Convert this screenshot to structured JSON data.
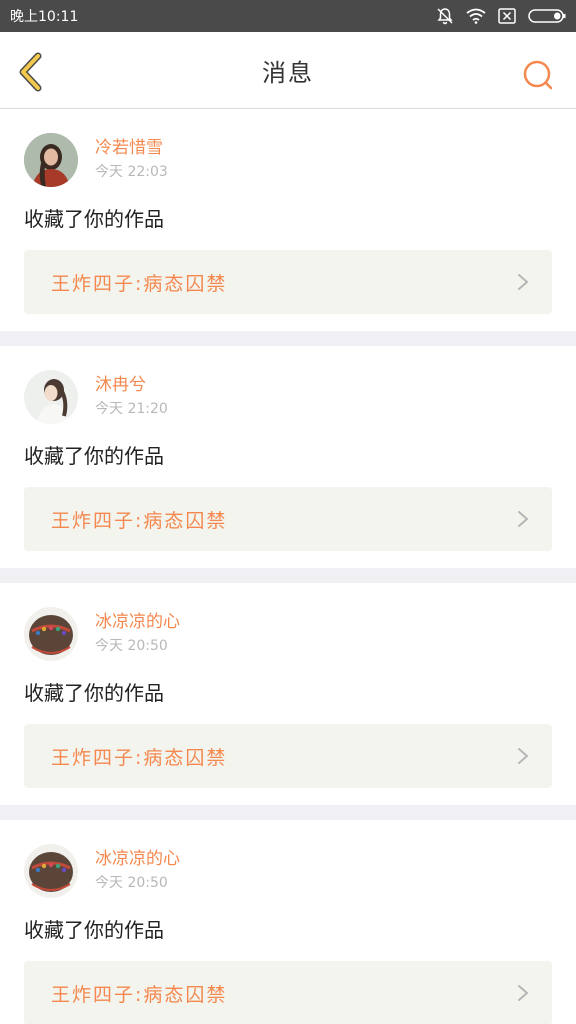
{
  "status_bar": {
    "time": "晚上10:11"
  },
  "header": {
    "title": "消息"
  },
  "colors": {
    "accent": "#f4884e",
    "title_bg": "#f4f4ef",
    "status_bar": "#4a4a4a",
    "back": "#f2c94c"
  },
  "icons": {
    "back": "chevron-left-icon",
    "search": "search-icon",
    "forward": "chevron-right-icon"
  },
  "notifications": [
    {
      "user": "冷若惜雪",
      "time": "今天 22:03",
      "action": "收藏了你的作品",
      "work": "王炸四子:病态囚禁"
    },
    {
      "user": "沐冉兮",
      "time": "今天 21:20",
      "action": "收藏了你的作品",
      "work": "王炸四子:病态囚禁"
    },
    {
      "user": "冰凉凉的心",
      "time": "今天 20:50",
      "action": "收藏了你的作品",
      "work": "王炸四子:病态囚禁"
    },
    {
      "user": "冰凉凉的心",
      "time": "今天 20:50",
      "action": "收藏了你的作品",
      "work": "王炸四子:病态囚禁"
    }
  ]
}
